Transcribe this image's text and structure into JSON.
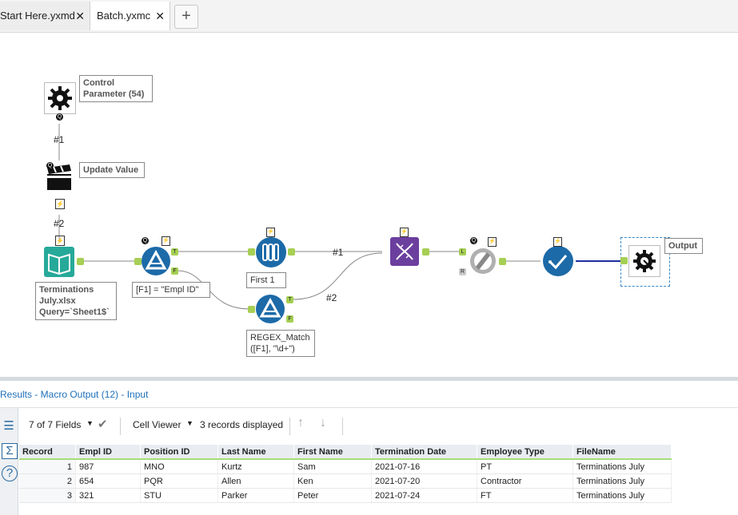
{
  "tabs": [
    {
      "label": "Start Here.yxmd",
      "close": "✕"
    },
    {
      "label": "Batch.yxmc",
      "close": "✕"
    }
  ],
  "add_tab": "+",
  "canvas": {
    "tools": {
      "control_parameter": "Control Parameter (54)",
      "update_value": "Update Value",
      "input": "Terminations July.xlsx Query=`Sheet1$`",
      "filter": "[F1] = \"Empl ID\"",
      "sample": "First 1",
      "regex_filter": "REGEX_Match ([F1], \"\\d+\")",
      "output": "Output"
    },
    "connection_labels": [
      "#1",
      "#2",
      "#1",
      "#2"
    ],
    "anchor_letters": {
      "q": "Q",
      "t": "T",
      "f": "F",
      "l": "L",
      "r": "R"
    }
  },
  "results": {
    "title": "Results - Macro Output (12) - Input",
    "fields_selector": "7 of 7 Fields",
    "viewer": "Cell Viewer",
    "records_displayed": "3 records displayed",
    "columns": [
      "Record",
      "Empl ID",
      "Position ID",
      "Last Name",
      "First Name",
      "Termination Date",
      "Employee Type",
      "FileName"
    ],
    "rows": [
      [
        "1",
        "987",
        "MNO",
        "Kurtz",
        "Sam",
        "2021-07-16",
        "PT",
        "Terminations July"
      ],
      [
        "2",
        "654",
        "PQR",
        "Allen",
        "Ken",
        "2021-07-20",
        "Contractor",
        "Terminations July"
      ],
      [
        "3",
        "321",
        "STU",
        "Parker",
        "Peter",
        "2021-07-24",
        "FT",
        "Terminations July"
      ]
    ]
  },
  "colors": {
    "accent": "#1e6fb8",
    "anchor": "#a6cf54",
    "tool_blue": "#1c6aa8",
    "tool_purple": "#6b3f9e",
    "tool_teal": "#27a99a"
  },
  "icons": {
    "control_parameter": "gear-icon",
    "update_value": "clapperboard-icon",
    "input": "book-icon",
    "filter": "filter-triangle-icon",
    "sample": "test-tubes-icon",
    "union": "dna-icon",
    "join": "saw-blade-icon",
    "select": "check-icon",
    "macro_output": "gear-arrow-icon"
  }
}
